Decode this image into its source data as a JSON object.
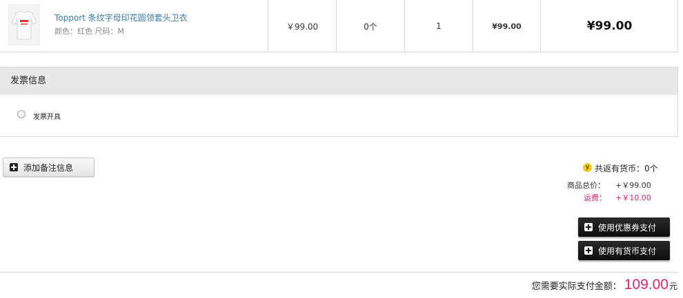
{
  "product": {
    "name": "Topport 条纹字母印花圆领套头卫衣",
    "attrs": "颜色：红色  尺码：M",
    "price": "￥99.00",
    "coins": "0个",
    "quantity": "1",
    "subtotal": "¥99.00",
    "total": "¥99.00"
  },
  "invoice": {
    "title": "发票信息",
    "option": "发票开具"
  },
  "remark": {
    "label": "添加备注信息"
  },
  "summary": {
    "coin_icon": "y",
    "coin_text": "共返有货币：0个",
    "goods_label": "商品总价：",
    "goods_value": "+￥99.00",
    "shipping_label": "运费：",
    "shipping_value": "+￥10.00"
  },
  "buttons": {
    "coupon": "使用优惠券支付",
    "currency": "使用有货币支付"
  },
  "payment": {
    "label": "您需要实际支付金额：",
    "amount": "109.00",
    "unit": "元"
  },
  "colors": {
    "accent": "#e0246f",
    "link": "#3a7ca5"
  }
}
